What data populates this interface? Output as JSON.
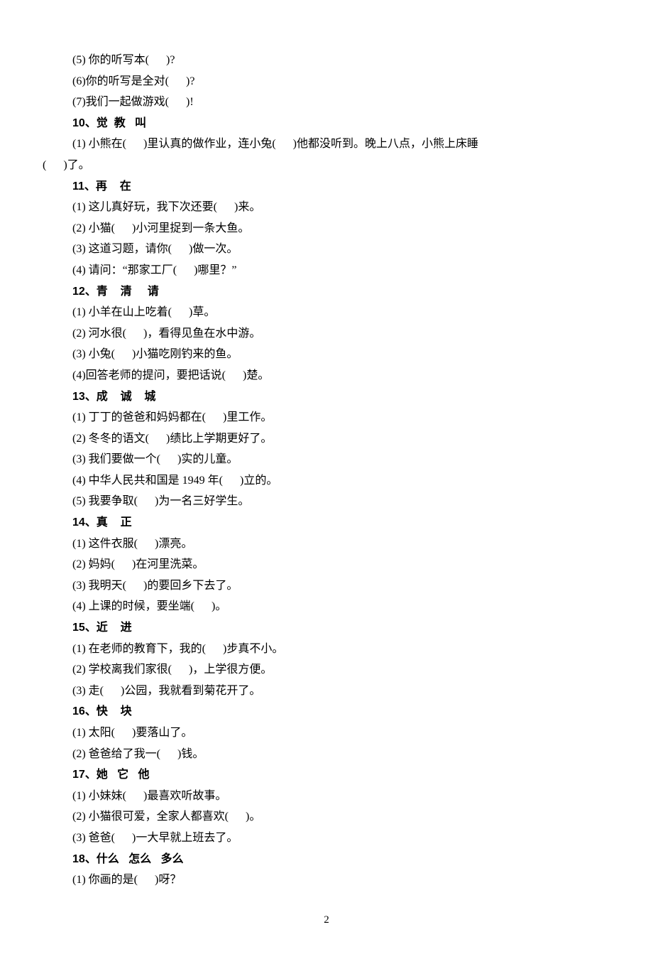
{
  "lines": [
    {
      "cls": "indent1",
      "text": "(5) 你的听写本(      )?"
    },
    {
      "cls": "indent1",
      "text": "(6)你的听写是全对(      )?"
    },
    {
      "cls": "indent1",
      "text": "(7)我们一起做游戏(      )!"
    },
    {
      "cls": "indent1 heading",
      "text": "10、觉  教   叫"
    },
    {
      "cls": "indent1",
      "text": "(1) 小熊在(      )里认真的做作业，连小兔(      )他都没听到。晚上八点，小熊上床睡"
    },
    {
      "cls": "noindent",
      "text": "(      )了。"
    },
    {
      "cls": "indent1 heading",
      "text": "11、再    在"
    },
    {
      "cls": "indent1",
      "text": "(1) 这儿真好玩，我下次还要(      )来。"
    },
    {
      "cls": "indent1",
      "text": "(2) 小猫(      )小河里捉到一条大鱼。"
    },
    {
      "cls": "indent1",
      "text": "(3) 这道习题，请你(      )做一次。"
    },
    {
      "cls": "indent1",
      "text": "(4) 请问：“那家工厂(      )哪里？”"
    },
    {
      "cls": "indent1 heading",
      "text": "12、青    清     请"
    },
    {
      "cls": "indent1",
      "text": "(1) 小羊在山上吃着(      )草。"
    },
    {
      "cls": "indent1",
      "text": "(2) 河水很(      )，看得见鱼在水中游。"
    },
    {
      "cls": "indent1",
      "text": "(3) 小兔(      )小猫吃刚钓来的鱼。"
    },
    {
      "cls": "indent1",
      "text": "(4)回答老师的提问，要把话说(      )楚。"
    },
    {
      "cls": "indent1 heading",
      "text": "13、成    诚    城"
    },
    {
      "cls": "indent1",
      "text": "(1) 丁丁的爸爸和妈妈都在(      )里工作。"
    },
    {
      "cls": "indent1",
      "text": "(2) 冬冬的语文(      )绩比上学期更好了。"
    },
    {
      "cls": "indent1",
      "text": "(3) 我们要做一个(      )实的儿童。"
    },
    {
      "cls": "indent1",
      "text": "(4) 中华人民共和国是 1949 年(      )立的。"
    },
    {
      "cls": "indent1",
      "text": "(5) 我要争取(      )为一名三好学生。"
    },
    {
      "cls": "indent1 heading",
      "text": "14、真    正"
    },
    {
      "cls": "indent1",
      "text": "(1) 这件衣服(      )漂亮。"
    },
    {
      "cls": "indent1",
      "text": "(2) 妈妈(      )在河里洗菜。"
    },
    {
      "cls": "indent1",
      "text": "(3) 我明天(      )的要回乡下去了。"
    },
    {
      "cls": "indent1",
      "text": "(4) 上课的时候，要坐端(      )。"
    },
    {
      "cls": "indent1 heading",
      "text": "15、近    进"
    },
    {
      "cls": "indent1",
      "text": "(1) 在老师的教育下，我的(      )步真不小。"
    },
    {
      "cls": "indent1",
      "text": "(2) 学校离我们家很(      )，上学很方便。"
    },
    {
      "cls": "indent1",
      "text": "(3) 走(      )公园，我就看到菊花开了。"
    },
    {
      "cls": "indent1 heading",
      "text": "16、快    块"
    },
    {
      "cls": "indent1",
      "text": "(1) 太阳(      )要落山了。"
    },
    {
      "cls": "indent1",
      "text": "(2) 爸爸给了我一(      )钱。"
    },
    {
      "cls": "indent1 heading",
      "text": "17、她   它   他"
    },
    {
      "cls": "indent1",
      "text": "(1) 小妹妹(      )最喜欢听故事。"
    },
    {
      "cls": "indent1",
      "text": "(2) 小猫很可爱，全家人都喜欢(      )。"
    },
    {
      "cls": "indent1",
      "text": "(3) 爸爸(      )一大早就上班去了。"
    },
    {
      "cls": "indent1 heading",
      "text": "18、什么   怎么   多么"
    },
    {
      "cls": "indent1",
      "text": "(1) 你画的是(      )呀？"
    }
  ],
  "page_number": "2"
}
